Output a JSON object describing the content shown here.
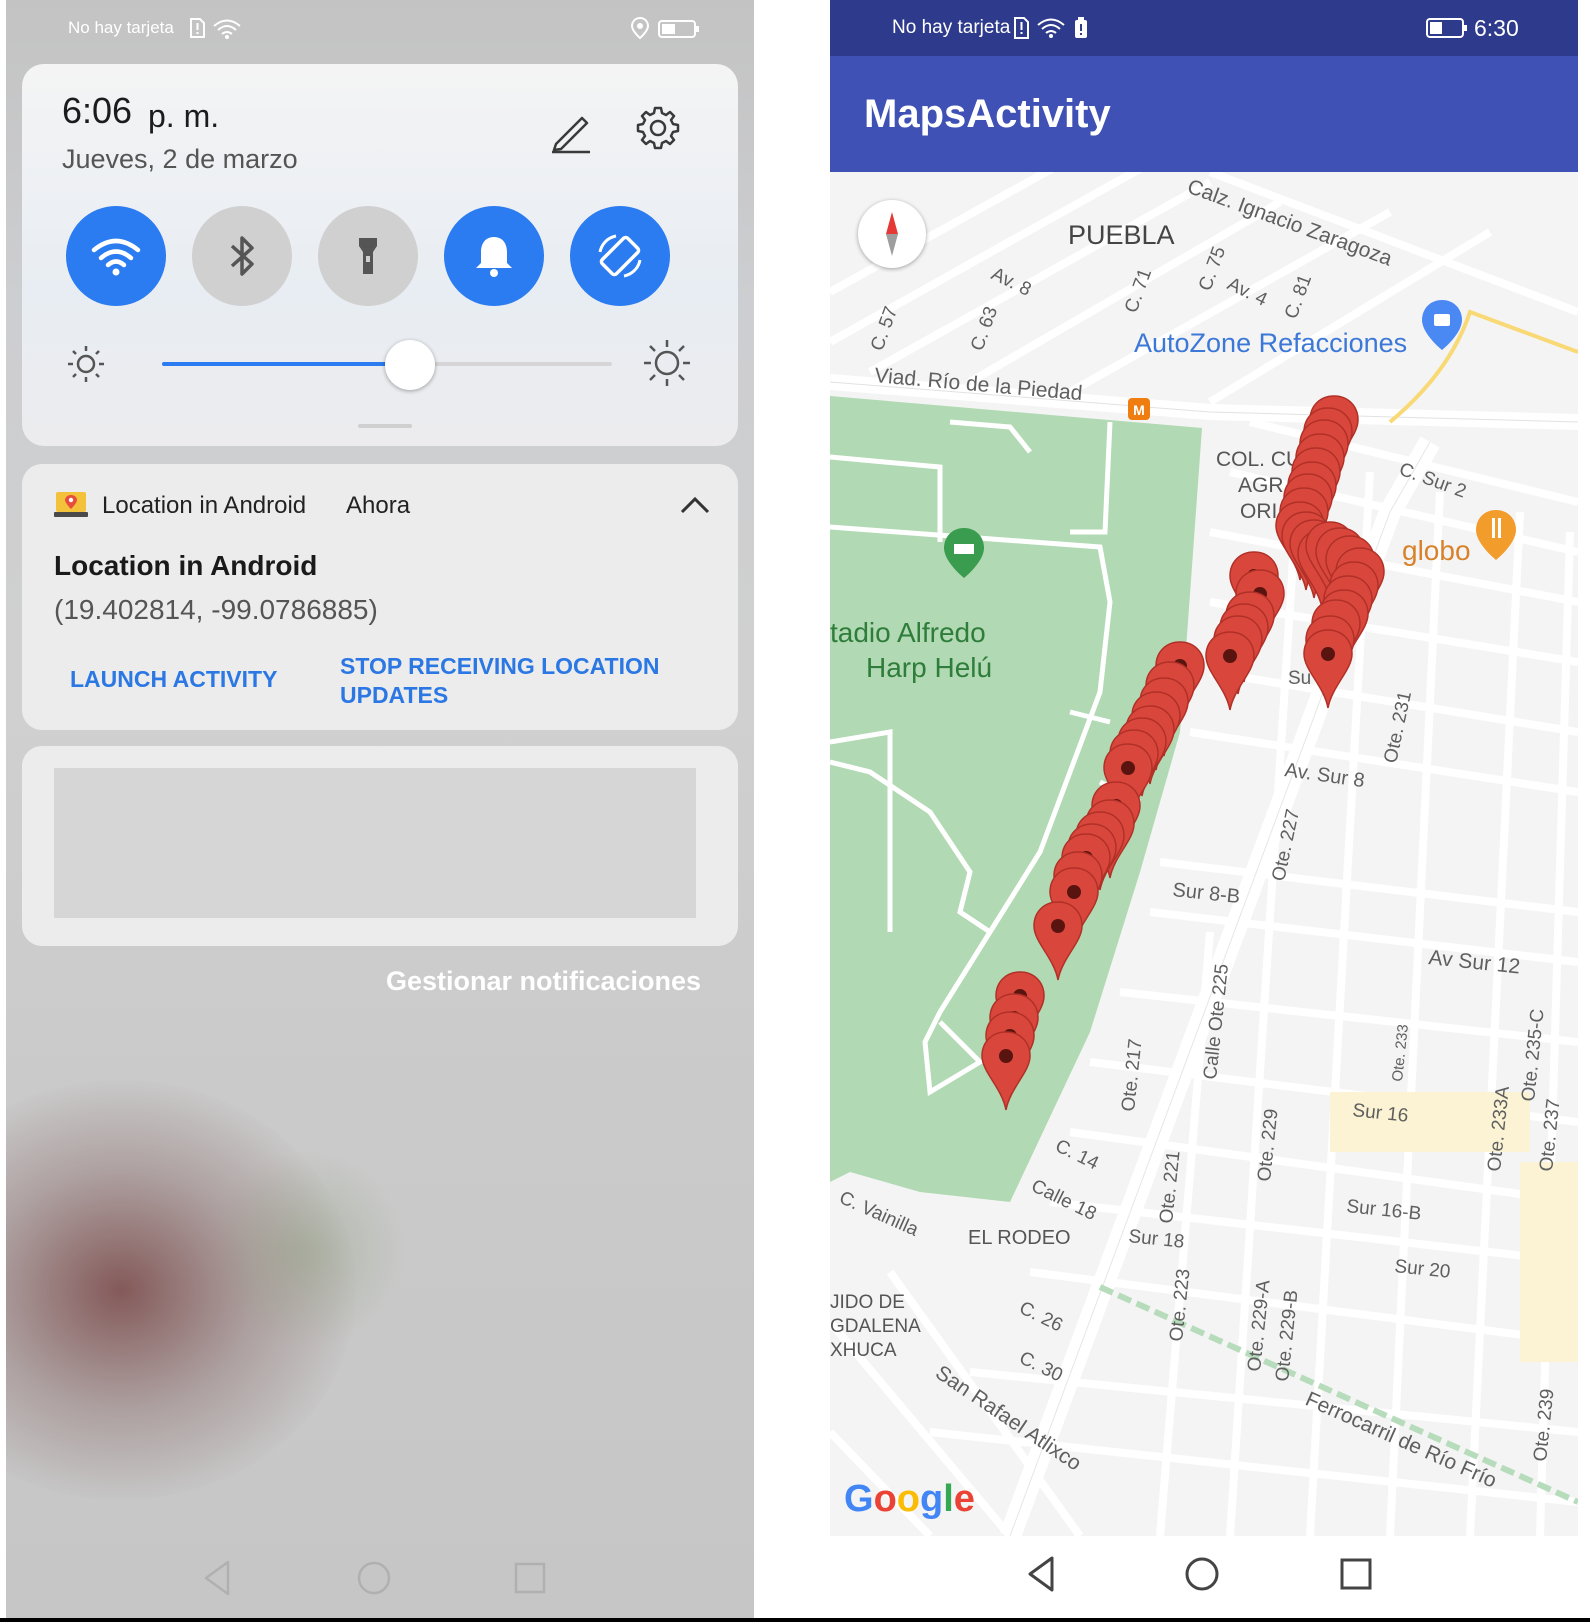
{
  "left": {
    "status_bar": {
      "carrier": "No hay tarjeta"
    },
    "quick_settings": {
      "time": "6:06",
      "ampm": "p. m.",
      "date": "Jueves, 2 de marzo",
      "brightness_level": 0.55,
      "tiles": [
        {
          "name": "wifi",
          "icon": "wifi-icon",
          "state": "on"
        },
        {
          "name": "bluetooth",
          "icon": "bluetooth-icon",
          "state": "off"
        },
        {
          "name": "flashlight",
          "icon": "flashlight-icon",
          "state": "off"
        },
        {
          "name": "sound",
          "icon": "bell-icon",
          "state": "on"
        },
        {
          "name": "auto-rotate",
          "icon": "rotate-icon",
          "state": "on"
        }
      ],
      "accent": "#2b7cf0"
    },
    "notification": {
      "app_name": "Location in Android",
      "when": "Ahora",
      "title": "Location in Android",
      "text": "(19.402814, -99.0786885)",
      "action_launch": "LAUNCH ACTIVITY",
      "action_stop": "STOP RECEIVING LOCATION UPDATES",
      "action_color": "#2b78e4"
    },
    "manage_label": "Gestionar notificaciones"
  },
  "right": {
    "status_bar": {
      "carrier": "No hay tarjeta",
      "time": "6:30"
    },
    "app_title": "MapsActivity",
    "app_bar_color": "#3f51b5",
    "map": {
      "labels": {
        "puebla": "PUEBLA",
        "zaragoza": "Calz. Ignacio Zaragoza",
        "av8": "Av. 8",
        "c57": "C. 57",
        "c63": "C. 63",
        "c71": "C. 71",
        "c75": "C. 75",
        "av4": "Av. 4",
        "c81": "C. 81",
        "autozone": "AutoZone Refacciones",
        "viaducto": "Viad. Río de la Piedad",
        "col_cu": "COL. CU",
        "agr": "AGR",
        "ori": "ORI",
        "csur2": "C. Sur 2",
        "globo": "globo",
        "estadio1": "tadio Alfredo",
        "estadio2": "Harp Helú",
        "sur_short": "Su",
        "ote231": "Ote. 231",
        "avsur8": "Av. Sur 8",
        "ote227": "Ote. 227",
        "sur8b": "Sur 8-B",
        "avsur12": "Av Sur 12",
        "ote225": "Calle Ote 225",
        "ote217": "Ote. 217",
        "ote233": "Ote. 233",
        "ote235c": "Ote. 235-C",
        "ote233a": "Ote. 233A",
        "ote237": "Ote. 237",
        "ote229": "Ote. 229",
        "sur16": "Sur 16",
        "c14": "C. 14",
        "calle18": "Calle 18",
        "ote221": "Ote. 221",
        "sur18": "Sur 18",
        "sur16b": "Sur 16-B",
        "vainilla": "C. Vainilla",
        "rodeo": "EL RODEO",
        "ote223": "Ote. 223",
        "ote229a": "Ote. 229-A",
        "ote229b": "Ote. 229-B",
        "sur20": "Sur 20",
        "ejido1": "JIDO DE",
        "ejido2": "GDALENA",
        "ejido3": "XHUCA",
        "c26": "C. 26",
        "c30": "C. 30",
        "atlixco": "San Rafael Atlixco",
        "ferrocarril": "Ferrocarril de Río Frío",
        "ote239": "Ote. 239"
      },
      "google_logo": "Google",
      "marker_color": "#d9473c",
      "marker_count": 48
    }
  }
}
